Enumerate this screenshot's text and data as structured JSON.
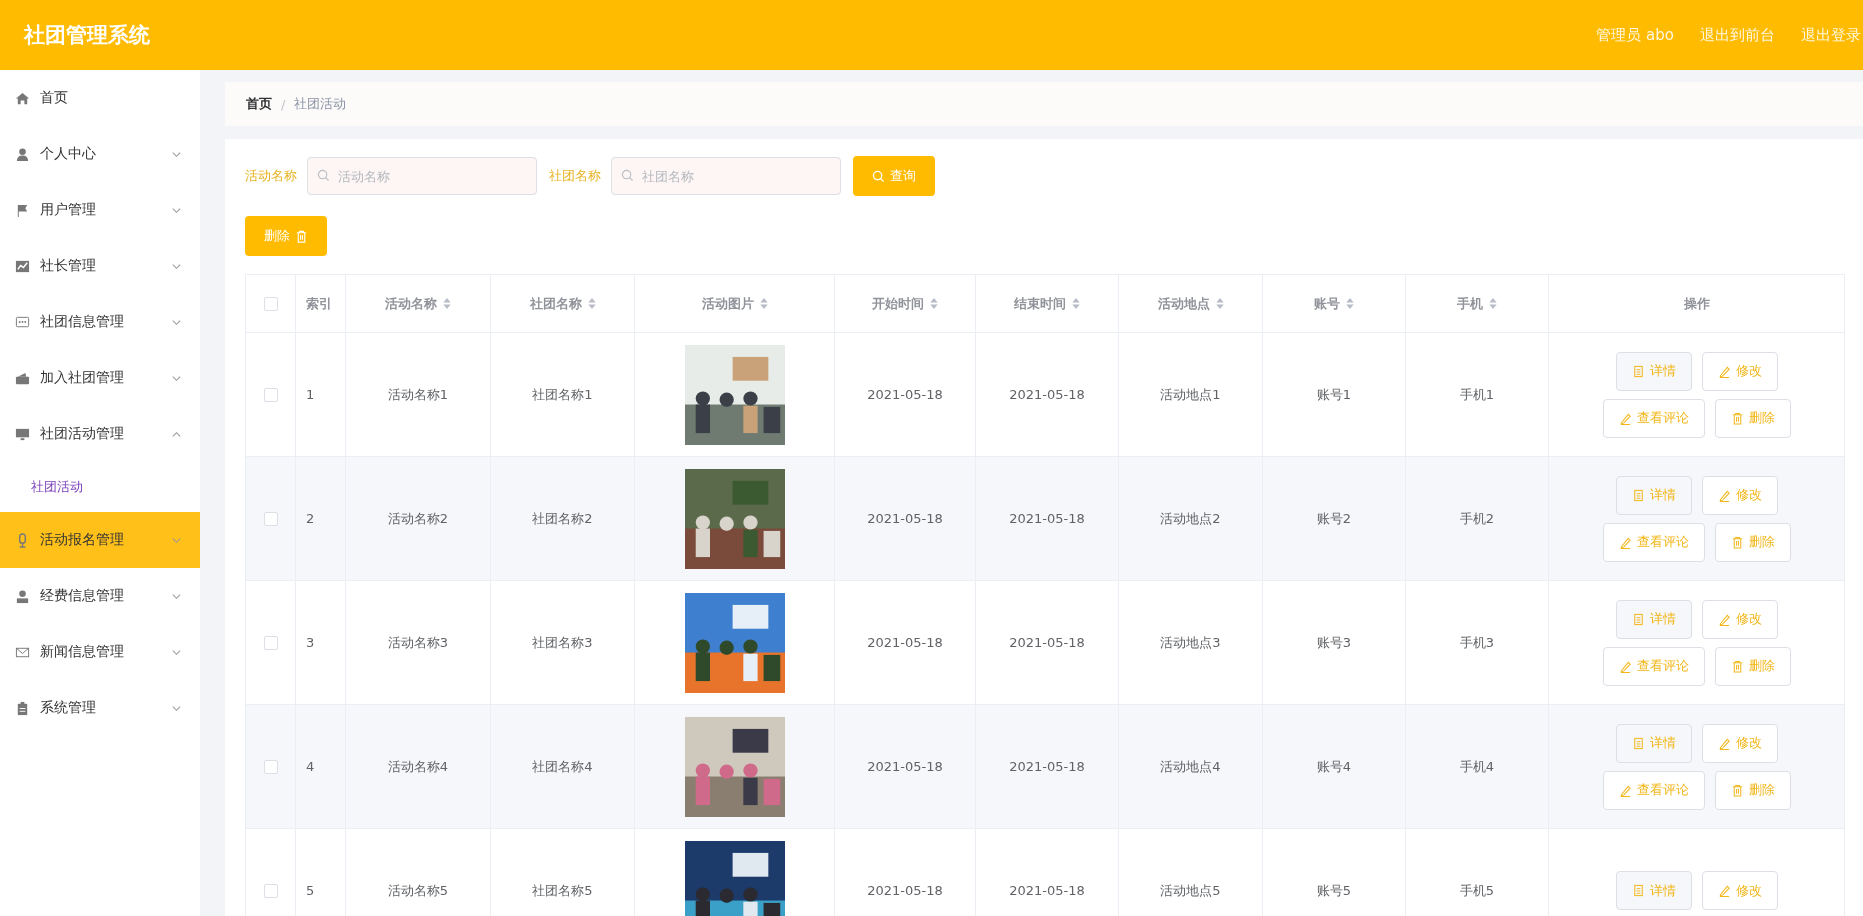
{
  "header": {
    "title": "社团管理系统",
    "links": [
      "管理员 abo",
      "退出到前台",
      "退出登录"
    ]
  },
  "sidebar": {
    "items": [
      {
        "label": "首页",
        "selected": false
      },
      {
        "label": "个人中心",
        "selected": false,
        "expanded": false
      },
      {
        "label": "用户管理",
        "selected": false,
        "expanded": false
      },
      {
        "label": "社长管理",
        "selected": false,
        "expanded": false
      },
      {
        "label": "社团信息管理",
        "selected": false,
        "expanded": false
      },
      {
        "label": "加入社团管理",
        "selected": false,
        "expanded": false
      },
      {
        "label": "社团活动管理",
        "selected": false,
        "expanded": true,
        "children": [
          {
            "label": "社团活动",
            "selected": true
          }
        ]
      },
      {
        "label": "活动报名管理",
        "selected": true,
        "expanded": false
      },
      {
        "label": "经费信息管理",
        "selected": false,
        "expanded": false
      },
      {
        "label": "新闻信息管理",
        "selected": false,
        "expanded": false
      },
      {
        "label": "系统管理",
        "selected": false,
        "expanded": false
      }
    ]
  },
  "breadcrumb": {
    "separator": "/",
    "items": [
      "首页",
      "社团活动"
    ]
  },
  "search": {
    "fields": [
      {
        "label": "活动名称",
        "placeholder": "活动名称"
      },
      {
        "label": "社团名称",
        "placeholder": "社团名称"
      }
    ],
    "button": "查询"
  },
  "delete_button": "删除",
  "table": {
    "header_checked": false,
    "columns": [
      {
        "label": "索引",
        "sortable": false
      },
      {
        "label": "活动名称",
        "sortable": true
      },
      {
        "label": "社团名称",
        "sortable": true
      },
      {
        "label": "活动图片",
        "sortable": true
      },
      {
        "label": "开始时间",
        "sortable": true
      },
      {
        "label": "结束时间",
        "sortable": true
      },
      {
        "label": "活动地点",
        "sortable": true
      },
      {
        "label": "账号",
        "sortable": true
      },
      {
        "label": "手机",
        "sortable": true
      },
      {
        "label": "操作",
        "sortable": false
      }
    ],
    "rows": [
      {
        "checked": false,
        "index": "1",
        "name": "活动名称1",
        "club": "社团名称1",
        "image": {
          "kind": "picture"
        },
        "start": "2021-05-18",
        "end": "2021-05-18",
        "place": "活动地点1",
        "account": "账号1",
        "phone": "手机1",
        "actions": [
          {
            "kind": "detail",
            "label": "详情"
          },
          {
            "kind": "edit",
            "label": "修改"
          },
          {
            "kind": "comment",
            "label": "查看评论"
          },
          {
            "kind": "delete",
            "label": "删除"
          }
        ]
      },
      {
        "checked": false,
        "index": "2",
        "name": "活动名称2",
        "club": "社团名称2",
        "image": {
          "kind": "picture"
        },
        "start": "2021-05-18",
        "end": "2021-05-18",
        "place": "活动地点2",
        "account": "账号2",
        "phone": "手机2",
        "actions": [
          {
            "kind": "detail",
            "label": "详情"
          },
          {
            "kind": "edit",
            "label": "修改"
          },
          {
            "kind": "comment",
            "label": "查看评论"
          },
          {
            "kind": "delete",
            "label": "删除"
          }
        ]
      },
      {
        "checked": false,
        "index": "3",
        "name": "活动名称3",
        "club": "社团名称3",
        "image": {
          "kind": "picture"
        },
        "start": "2021-05-18",
        "end": "2021-05-18",
        "place": "活动地点3",
        "account": "账号3",
        "phone": "手机3",
        "actions": [
          {
            "kind": "detail",
            "label": "详情"
          },
          {
            "kind": "edit",
            "label": "修改"
          },
          {
            "kind": "comment",
            "label": "查看评论"
          },
          {
            "kind": "delete",
            "label": "删除"
          }
        ]
      },
      {
        "checked": false,
        "index": "4",
        "name": "活动名称4",
        "club": "社团名称4",
        "image": {
          "kind": "picture"
        },
        "start": "2021-05-18",
        "end": "2021-05-18",
        "place": "活动地点4",
        "account": "账号4",
        "phone": "手机4",
        "actions": [
          {
            "kind": "detail",
            "label": "详情"
          },
          {
            "kind": "edit",
            "label": "修改"
          },
          {
            "kind": "comment",
            "label": "查看评论"
          },
          {
            "kind": "delete",
            "label": "删除"
          }
        ]
      },
      {
        "checked": false,
        "index": "5",
        "name": "活动名称5",
        "club": "社团名称5",
        "image": {
          "kind": "picture"
        },
        "start": "2021-05-18",
        "end": "2021-05-18",
        "place": "活动地点5",
        "account": "账号5",
        "phone": "手机5",
        "actions": [
          {
            "kind": "detail",
            "label": "详情"
          },
          {
            "kind": "edit",
            "label": "修改"
          }
        ]
      }
    ]
  }
}
